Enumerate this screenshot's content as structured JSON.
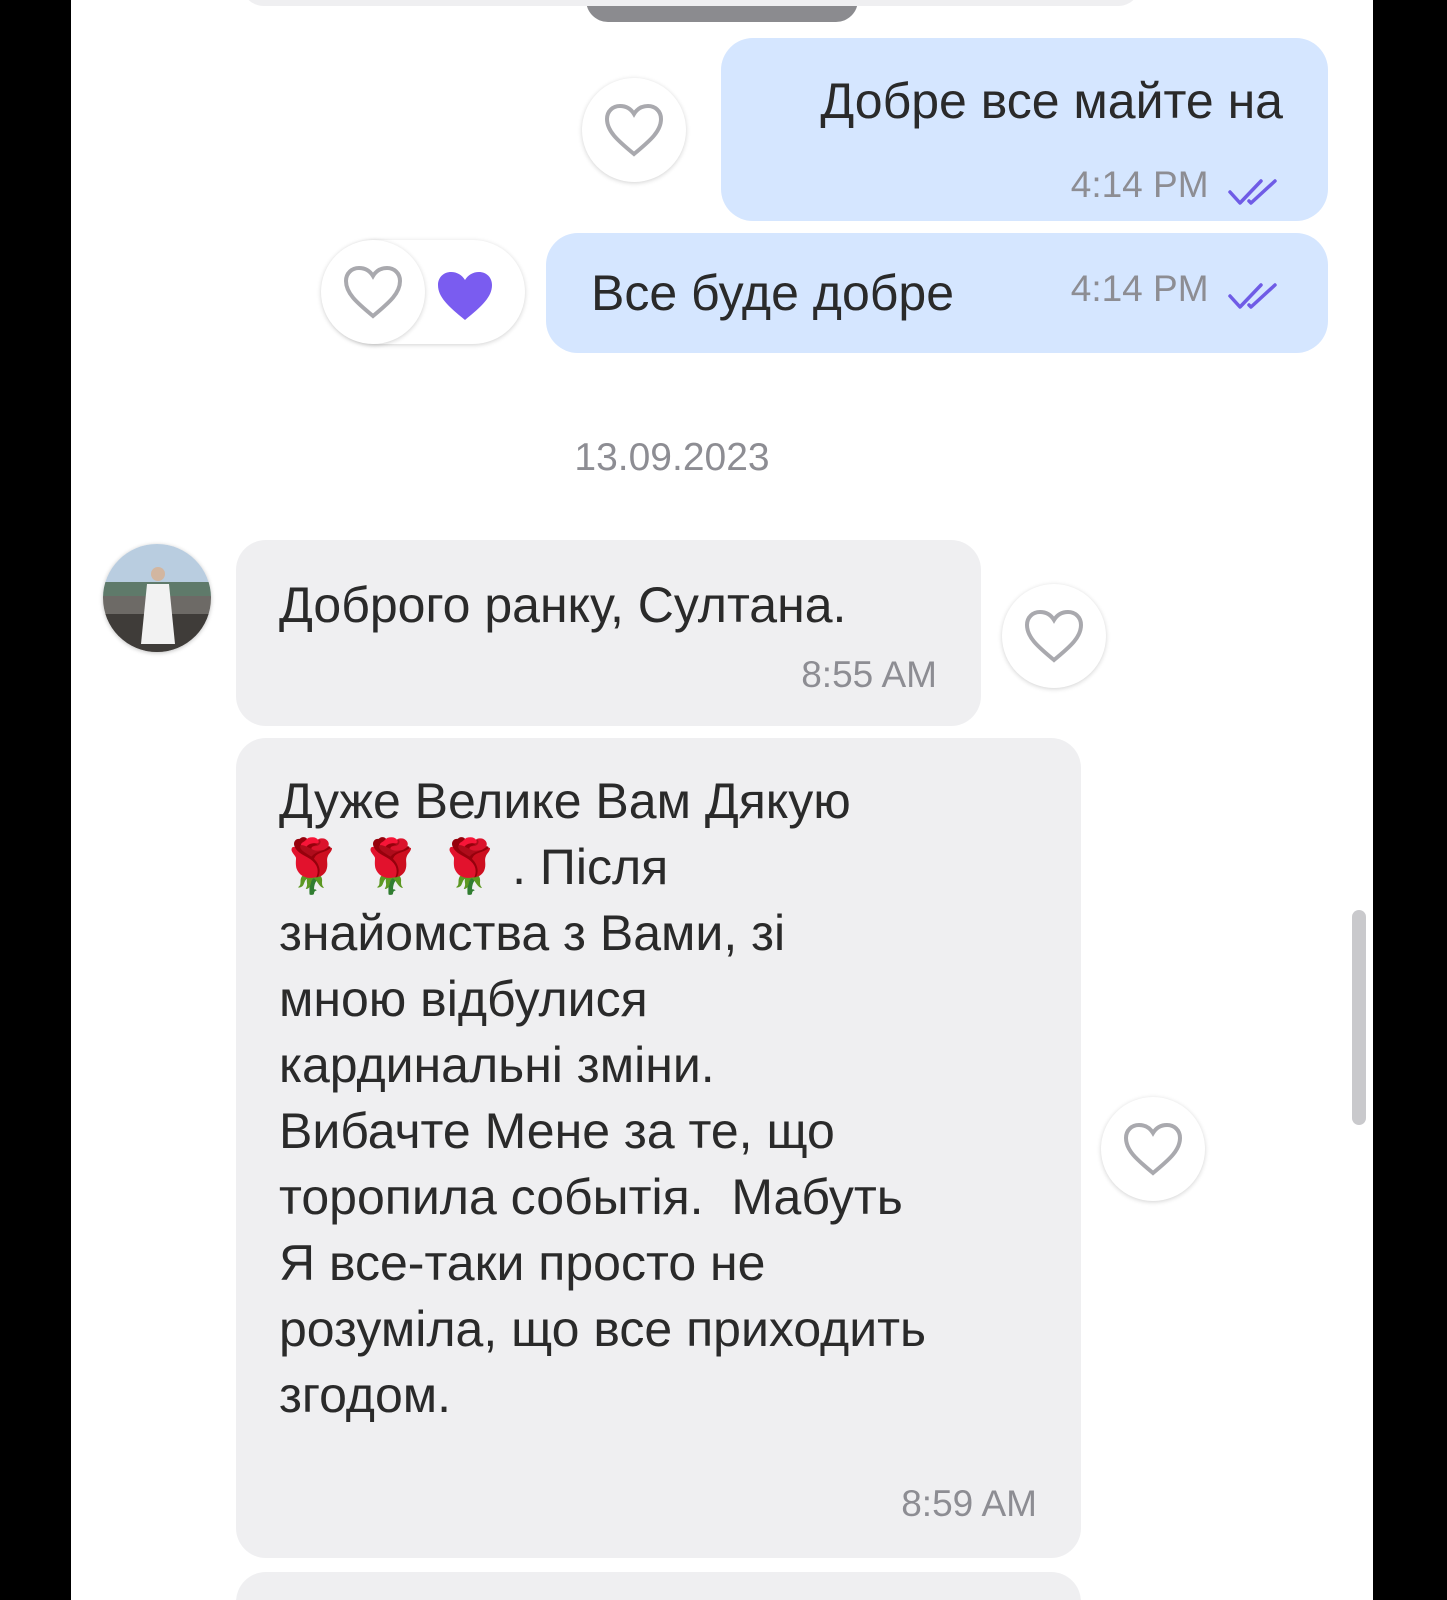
{
  "messages": {
    "m1": {
      "text": "Добре все майте на",
      "time": "4:14 PM"
    },
    "m2": {
      "text": "Все буде добре",
      "time": "4:14 PM",
      "reaction": "heart-filled"
    },
    "m3": {
      "text": "Доброго ранку, Султана.",
      "time": "8:55 AM"
    },
    "m4": {
      "line1": "Дуже Велике Вам Дякую",
      "emoji": "🌹 🌹 🌹",
      "line2": ". Після",
      "line3": "знайомства з Вами, зі",
      "line4": "мною відбулися",
      "line5": "кардинальні зміни.",
      "line6": "Вибачте Мене за те, що",
      "line7": "торопила событія.  Мабуть",
      "line8": "Я все-таки просто не",
      "line9": "розуміла, що все приходить",
      "line10": "згодом.",
      "time": "8:59 AM"
    }
  },
  "date_separator": "13.09.2023",
  "colors": {
    "outgoing_bubble": "#d5e6ff",
    "incoming_bubble": "#efeff1",
    "accent": "#7a5cf0",
    "read_ticks": "#6f5ce6"
  }
}
